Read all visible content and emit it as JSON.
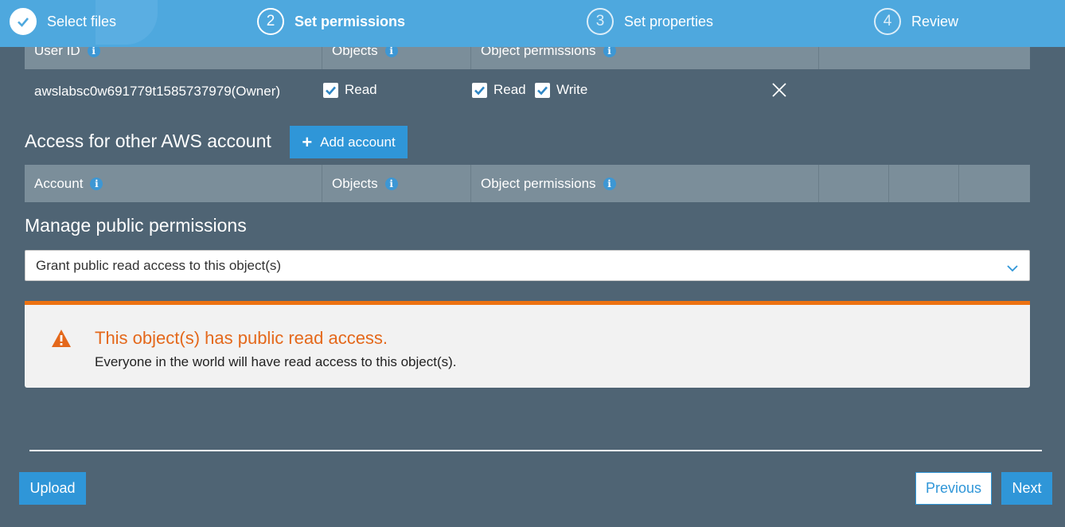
{
  "stepper": {
    "steps": [
      {
        "number": "",
        "label": "Select files",
        "state": "complete"
      },
      {
        "number": "2",
        "label": "Set permissions",
        "state": "active"
      },
      {
        "number": "3",
        "label": "Set properties",
        "state": "pending"
      },
      {
        "number": "4",
        "label": "Review",
        "state": "pending"
      }
    ]
  },
  "owner_table": {
    "headers": [
      "User ID",
      "Objects",
      "Object permissions"
    ],
    "row": {
      "user_id": "awslabsc0w691779t1585737979(Owner)",
      "objects_read": "Read",
      "perm_read": "Read",
      "perm_write": "Write"
    }
  },
  "other_accounts": {
    "title": "Access for other AWS account",
    "add_button": "Add account",
    "headers": [
      "Account",
      "Objects",
      "Object permissions"
    ]
  },
  "public": {
    "title": "Manage public permissions",
    "selected": "Grant public read access to this object(s)"
  },
  "alert": {
    "title": "This object(s) has public read access.",
    "body": "Everyone in the world will have read access to this object(s)."
  },
  "footer": {
    "upload": "Upload",
    "previous": "Previous",
    "next": "Next"
  },
  "colors": {
    "header": "#4ea8de",
    "background": "#4f6474",
    "accent": "#2f96d8",
    "warning": "#ec7211"
  }
}
